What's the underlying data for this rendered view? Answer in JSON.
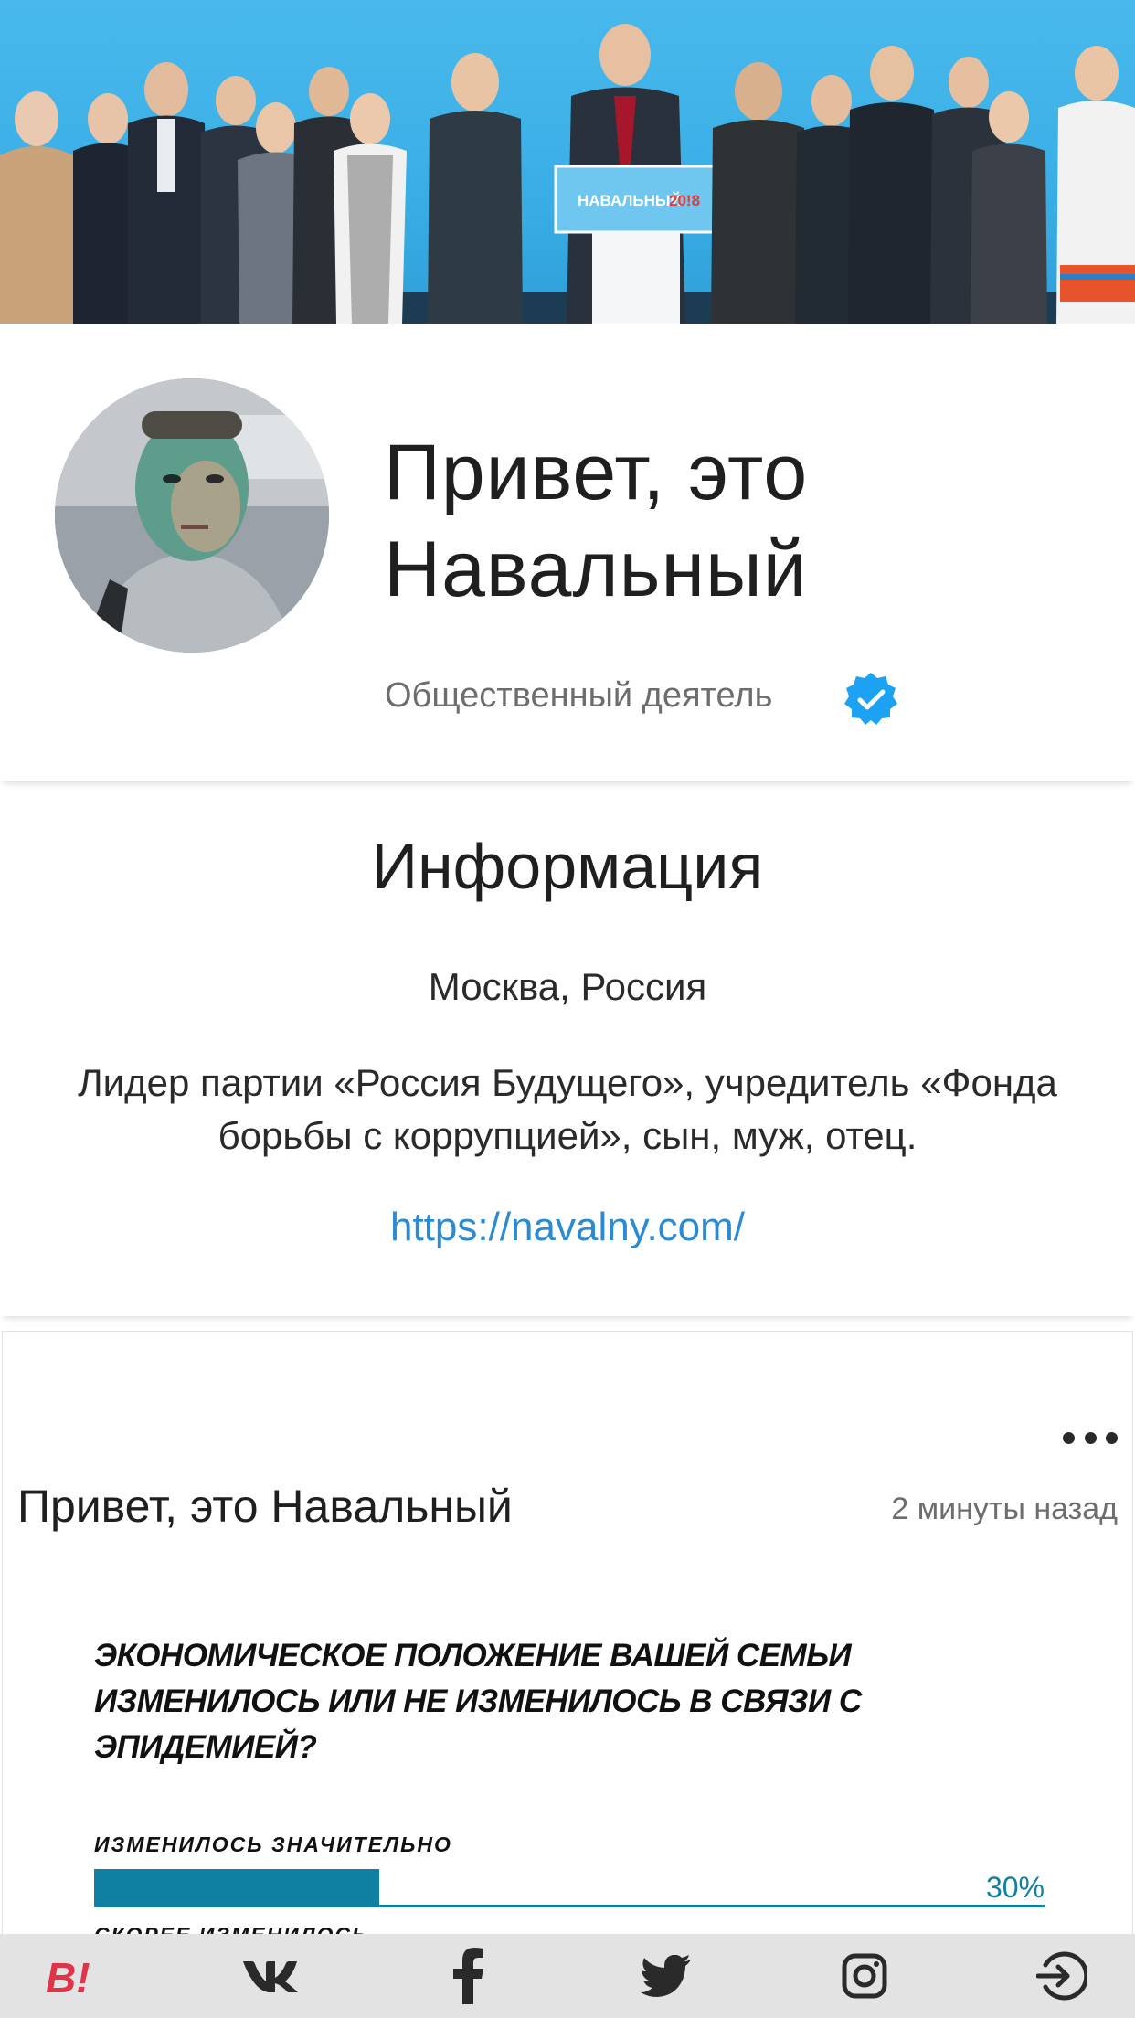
{
  "banner": {
    "podium_text": "НАВАЛЬНЫЙ",
    "podium_year": "20!8",
    "accent_color": "#39aee6"
  },
  "profile": {
    "name": "Привет, это Навальный",
    "role": "Общественный деятель",
    "verified_icon": "verified-badge-icon",
    "verified_color": "#1da1f2"
  },
  "info": {
    "heading": "Информация",
    "location": "Москва, Россия",
    "bio": "Лидер партии «Россия Будущего», учредитель «Фонда борьбы с коррупцией», сын, муж, отец.",
    "link": "https://navalny.com/"
  },
  "post": {
    "author": "Привет, это Навальный",
    "time": "2 минуты назад",
    "menu_icon": "more-dots-icon",
    "headline": "ЭКОНОМИЧЕСКОЕ ПОЛОЖЕНИЕ ВАШЕЙ СЕМЬИ ИЗМЕНИЛОСЬ ИЛИ НЕ ИЗМЕНИЛОСЬ В СВЯЗИ С ЭПИДЕМИЕЙ?",
    "bars": [
      {
        "label": "ИЗМЕНИЛОСЬ ЗНАЧИТЕЛЬНО",
        "value_text": "30%",
        "value": 30
      },
      {
        "label": "СКОРЕЕ ИЗМЕНИЛОСЬ"
      }
    ],
    "bar_color": "#0f7fa2"
  },
  "bottom_nav": {
    "items": [
      {
        "icon": "app-logo-icon",
        "label": "В!"
      },
      {
        "icon": "vk-icon"
      },
      {
        "icon": "facebook-icon"
      },
      {
        "icon": "twitter-icon"
      },
      {
        "icon": "instagram-icon"
      },
      {
        "icon": "login-icon"
      }
    ]
  }
}
